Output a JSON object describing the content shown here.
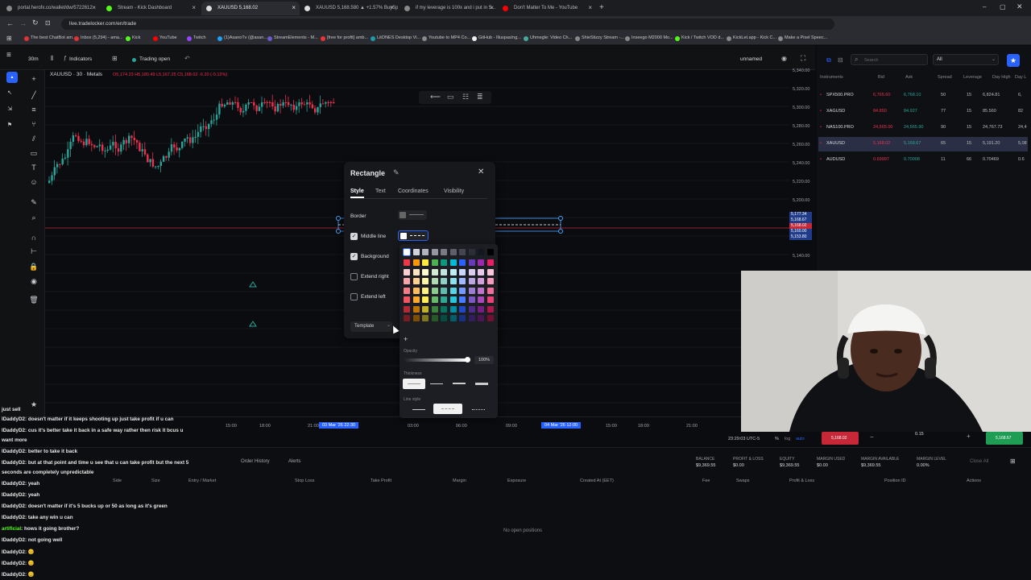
{
  "browser": {
    "tabs": [
      {
        "label": "portal.herofx.co/wallet/dw/5722612",
        "color": "#888"
      },
      {
        "label": "Stream - Kick Dashboard",
        "color": "#53fc18"
      },
      {
        "label": "XAUUSD 5,168.02",
        "color": "#ddd"
      },
      {
        "label": "XAUUSD 5,168.580 ▲ +1.57% BuySp...",
        "color": "#ddd"
      },
      {
        "label": "if my leverage is 100x and i put in 5...",
        "color": "#888"
      },
      {
        "label": "Don't Matter To Me - YouTube",
        "color": "#ff0000"
      }
    ],
    "url": "live.tradelocker.com/en/trade",
    "bookmarks": [
      {
        "label": "The best ChatBot am...",
        "color": "#d33"
      },
      {
        "label": "Inbox (5,294) - ama...",
        "color": "#d33"
      },
      {
        "label": "Kick",
        "color": "#53fc18"
      },
      {
        "label": "YouTube",
        "color": "#f00"
      },
      {
        "label": "Twitch",
        "color": "#9146ff"
      },
      {
        "label": "(1)AsanoTv (@asan...",
        "color": "#1da1f2"
      },
      {
        "label": "StreamElements - M...",
        "color": "#6a5acd"
      },
      {
        "label": "[free for profit] amb...",
        "color": "#e33"
      },
      {
        "label": "LitONES Desktop Vi...",
        "color": "#29a"
      },
      {
        "label": "Youtube to MP4 Co...",
        "color": "#888"
      },
      {
        "label": "GitHub - Illuspas/ng...",
        "color": "#eee"
      },
      {
        "label": "Uhmegle: Video Ch...",
        "color": "#4a9"
      },
      {
        "label": "ShieStizzy Stream -...",
        "color": "#888"
      },
      {
        "label": "Inseego M2000 Mo...",
        "color": "#888"
      },
      {
        "label": "Kick / Twitch VOD d...",
        "color": "#53fc18"
      },
      {
        "label": "KickLet.app - Kick C...",
        "color": "#888"
      },
      {
        "label": "Make a Pixel Speec...",
        "color": "#888"
      }
    ]
  },
  "toolbar": {
    "timeframe": "30m",
    "indicators": "Indicators",
    "trading": "Trading open",
    "layout": "unnamed"
  },
  "symbol": {
    "name": "XAUUSD · 30 · Metals",
    "ohlc": "O5,174.23 H5,180.49 L5,167.25 C5,168.02 -6.20 (-0.12%)"
  },
  "price_axis": [
    "5,340.00",
    "5,320.00",
    "5,300.00",
    "5,280.00",
    "5,260.00",
    "5,240.00",
    "5,220.00",
    "5,200.00",
    "5,180.00",
    "5,160.00",
    "5,140.00"
  ],
  "price_tags": [
    "5,177.34",
    "5,168.67",
    "5,168.02",
    "5,160.00",
    "5,153.80"
  ],
  "time_axis": [
    "15:00",
    "18:00",
    "21:00",
    "03 Mar '26 22:30",
    "03:00",
    "06:00",
    "09:00",
    "04 Mar '26 12:00",
    "15:00",
    "18:00",
    "21:00"
  ],
  "clock": "23:29:03 UTC-5",
  "dialog": {
    "title": "Rectangle",
    "tabs": [
      "Style",
      "Text",
      "Coordinates",
      "Visibility"
    ],
    "rows": [
      {
        "label": "Border",
        "checked": null
      },
      {
        "label": "Middle line",
        "checked": true
      },
      {
        "label": "Background",
        "checked": true
      },
      {
        "label": "Extend right",
        "checked": false
      },
      {
        "label": "Extend left",
        "checked": false
      }
    ],
    "template": "Template"
  },
  "picker": {
    "opacity_label": "Opacity",
    "opacity": "100%",
    "thickness_label": "Thickness",
    "style_label": "Line style",
    "add": "+"
  },
  "watchlist": {
    "search": "Search",
    "filter": "All",
    "headers": [
      "Instruments",
      "Bid",
      "Ask",
      "Spread",
      "Leverage",
      "Day High",
      "Day L"
    ],
    "rows": [
      {
        "sym": "SPX500.PRO",
        "bid": "6,765.60",
        "ask": "6,768.10",
        "spread": "50",
        "lev": "15",
        "high": "6,824.81",
        "low": "6,"
      },
      {
        "sym": "XAGUSD",
        "bid": "84.850",
        "ask": "84.927",
        "spread": "77",
        "lev": "15",
        "high": "85.560",
        "low": "82"
      },
      {
        "sym": "NAS100.PRO",
        "bid": "24,565.00",
        "ask": "24,565.90",
        "spread": "90",
        "lev": "15",
        "high": "24,767.73",
        "low": "24,4"
      },
      {
        "sym": "XAUUSD",
        "bid": "5,168.02",
        "ask": "5,168.67",
        "spread": "65",
        "lev": "15",
        "high": "5,191.20",
        "low": "5,08"
      },
      {
        "sym": "AUDUSD",
        "bid": "0.69997",
        "ask": "0.70008",
        "spread": "11",
        "lev": "66",
        "high": "0.70469",
        "low": "0.6"
      }
    ]
  },
  "account": {
    "labels": [
      "BALANCE",
      "PROFIT & LOSS",
      "EQUITY",
      "MARGIN USED",
      "MARGIN AVAILABLE",
      "MARGIN LEVEL"
    ],
    "values": [
      "$9,369.55",
      "$0.00",
      "$9,369.55",
      "$0.00",
      "$9,369.55",
      "0.00%"
    ],
    "sell": "5,168.02",
    "buy": "5,168.67",
    "lots": "0.15"
  },
  "positions": {
    "tab": "Order History",
    "alerts": "Alerts",
    "headers": [
      "Side",
      "Size",
      "Entry / Market",
      "Stop Loss",
      "Take Profit",
      "Margin",
      "Exposure",
      "Created At (EET)",
      "Fee",
      "Swaps",
      "Profit & Loss",
      "Position ID",
      "Actions"
    ],
    "empty": "No open positions"
  },
  "chat": [
    {
      "user": "",
      "text": "just sell"
    },
    {
      "user": "IDaddyD2",
      "text": ": doesn't matter if it keeps shooting up just take profit if u can"
    },
    {
      "user": "IDaddyD2",
      "text": ": cus it's better take it back in a safe way rather then risk it bcus u"
    },
    {
      "user": "",
      "text": "want more"
    },
    {
      "user": "IDaddyD2",
      "text": ": better to take it back"
    },
    {
      "user": "IDaddyD2",
      "text": ": but at that point and time u see that u can take profit but the next 5"
    },
    {
      "user": "",
      "text": "seconds are completely unpredictable"
    },
    {
      "user": "IDaddyD2",
      "text": ": yeah"
    },
    {
      "user": "IDaddyD2",
      "text": ": yeah"
    },
    {
      "user": "IDaddyD2",
      "text": ": doesn't matter if it's 5 bucks up or 50 as long as it's green"
    },
    {
      "user": "IDaddyD2",
      "text": ": take any win u can"
    },
    {
      "user": "artificial",
      "text": ": hows it going brother?"
    },
    {
      "user": "IDaddyD2",
      "text": ": not going well"
    },
    {
      "user": "IDaddyD2",
      "text": ": 😊"
    },
    {
      "user": "IDaddyD2",
      "text": ": 😊"
    },
    {
      "user": "IDaddyD2",
      "text": ": 😊"
    }
  ],
  "colors": {
    "up": "#26a69a",
    "down": "#ef2f4f",
    "accent": "#2962ff",
    "bg": "#0b0c0f"
  }
}
